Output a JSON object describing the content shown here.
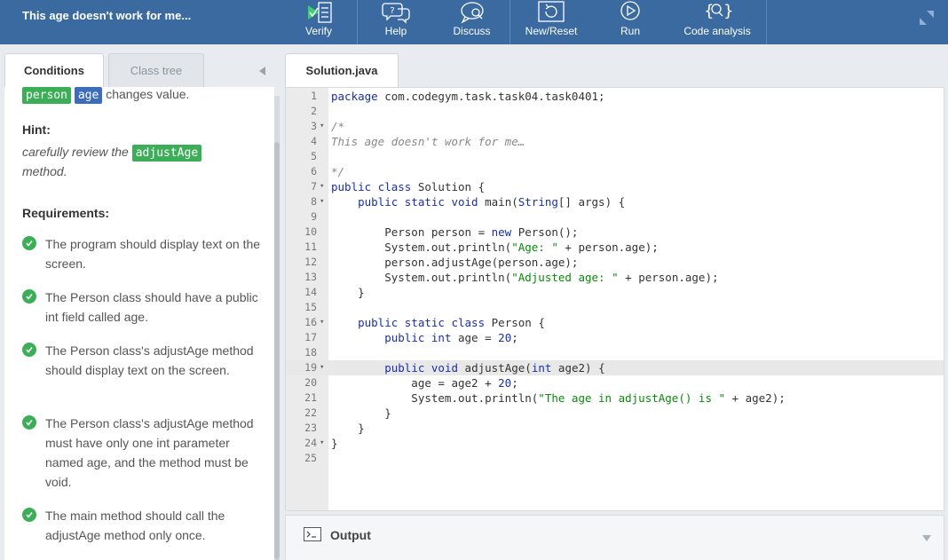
{
  "header": {
    "title": "This age doesn't work for me...",
    "toolbar": [
      {
        "label": "Verify",
        "icon": "verify-icon"
      },
      {
        "label": "Help",
        "icon": "help-icon"
      },
      {
        "label": "Discuss",
        "icon": "discuss-icon"
      },
      {
        "label": "New/Reset",
        "icon": "reset-icon"
      },
      {
        "label": "Run",
        "icon": "run-icon"
      },
      {
        "label": "Code analysis",
        "icon": "code-analysis-icon"
      }
    ]
  },
  "left_tabs": {
    "conditions": "Conditions",
    "class_tree": "Class tree"
  },
  "conditions": {
    "top_tag_1": "person",
    "top_tag_2": "age",
    "top_text": " changes value.",
    "hint_title": "Hint:",
    "hint_text_before": "carefully review the ",
    "hint_tag": "adjustAge",
    "hint_text_after": "method.",
    "requirements_title": "Requirements:",
    "requirements": [
      "The program should display text on the screen.",
      "The Person class should have a public int field called age.",
      "The Person class's adjustAge method should display text on the screen.",
      "The Person class's adjustAge method must have only one int parameter named age, and the method must be void.",
      "The main method should call the adjustAge method only once."
    ]
  },
  "editor": {
    "file_name": "Solution.java",
    "highlighted_line": 19,
    "lines": [
      {
        "n": "1",
        "fold": "",
        "code": "package com.codegym.task.task04.task0401;"
      },
      {
        "n": "2",
        "fold": "",
        "code": ""
      },
      {
        "n": "3",
        "fold": "▾",
        "code": "/*"
      },
      {
        "n": "4",
        "fold": "",
        "code": "This age doesn't work for me…"
      },
      {
        "n": "5",
        "fold": "",
        "code": ""
      },
      {
        "n": "6",
        "fold": "",
        "code": "*/"
      },
      {
        "n": "7",
        "fold": "▾",
        "code": "public class Solution {"
      },
      {
        "n": "8",
        "fold": "▾",
        "code": "    public static void main(String[] args) {"
      },
      {
        "n": "9",
        "fold": "",
        "code": ""
      },
      {
        "n": "10",
        "fold": "",
        "code": "        Person person = new Person();"
      },
      {
        "n": "11",
        "fold": "",
        "code": "        System.out.println(\"Age: \" + person.age);"
      },
      {
        "n": "12",
        "fold": "",
        "code": "        person.adjustAge(person.age);"
      },
      {
        "n": "13",
        "fold": "",
        "code": "        System.out.println(\"Adjusted age: \" + person.age);"
      },
      {
        "n": "14",
        "fold": "",
        "code": "    }"
      },
      {
        "n": "15",
        "fold": "",
        "code": ""
      },
      {
        "n": "16",
        "fold": "▾",
        "code": "    public static class Person {"
      },
      {
        "n": "17",
        "fold": "",
        "code": "        public int age = 20;"
      },
      {
        "n": "18",
        "fold": "",
        "code": ""
      },
      {
        "n": "19",
        "fold": "▾",
        "code": "        public void adjustAge(int age2) {"
      },
      {
        "n": "20",
        "fold": "",
        "code": "            age = age2 + 20;"
      },
      {
        "n": "21",
        "fold": "",
        "code": "            System.out.println(\"The age in adjustAge() is \" + age2);"
      },
      {
        "n": "22",
        "fold": "",
        "code": "        }"
      },
      {
        "n": "23",
        "fold": "",
        "code": "    }"
      },
      {
        "n": "24",
        "fold": "▾",
        "code": "}"
      },
      {
        "n": "25",
        "fold": "",
        "code": ""
      }
    ]
  },
  "output": {
    "title": "Output"
  },
  "colors": {
    "header": "#3a6aa0",
    "tag_green": "#3cae57",
    "tag_blue": "#3d6db8",
    "check": "#3cae57"
  }
}
